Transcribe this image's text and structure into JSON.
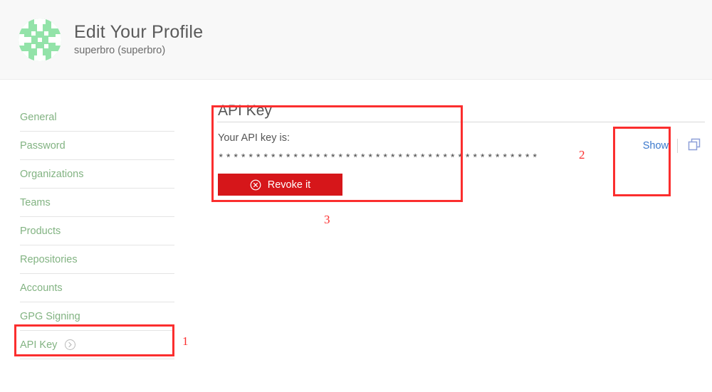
{
  "header": {
    "title": "Edit Your Profile",
    "subtitle": "superbro (superbro)",
    "avatar_icon": "identicon-avatar",
    "avatar_color": "#93e3a9",
    "background": "#f8f8f8"
  },
  "sidebar": {
    "items": [
      {
        "label": "General",
        "icon": "",
        "active": false
      },
      {
        "label": "Password",
        "icon": "",
        "active": false
      },
      {
        "label": "Organizations",
        "icon": "",
        "active": false
      },
      {
        "label": "Teams",
        "icon": "",
        "active": false
      },
      {
        "label": "Products",
        "icon": "",
        "active": false
      },
      {
        "label": "Repositories",
        "icon": "",
        "active": false
      },
      {
        "label": "Accounts",
        "icon": "",
        "active": false
      },
      {
        "label": "GPG Signing",
        "icon": "",
        "active": false
      },
      {
        "label": "API Key",
        "icon": "chevron-right-circle-icon",
        "active": true
      }
    ],
    "link_color": "#82b382"
  },
  "main": {
    "section_heading": "API Key",
    "description": "Your API key is:",
    "masked_key": "*******************************************",
    "revoke_button": {
      "label": "Revoke it",
      "icon": "x-circle-icon",
      "color": "#d6161a"
    },
    "show_link": {
      "label": "Show",
      "color": "#3a78cc"
    },
    "copy_icon": "copy-icon"
  },
  "annotations": {
    "color": "#fb2e2e",
    "markers": [
      {
        "number": "1",
        "target": "sidebar-item-api-key"
      },
      {
        "number": "2",
        "target": "show-link"
      },
      {
        "number": "3",
        "target": "api-key-panel"
      }
    ]
  }
}
